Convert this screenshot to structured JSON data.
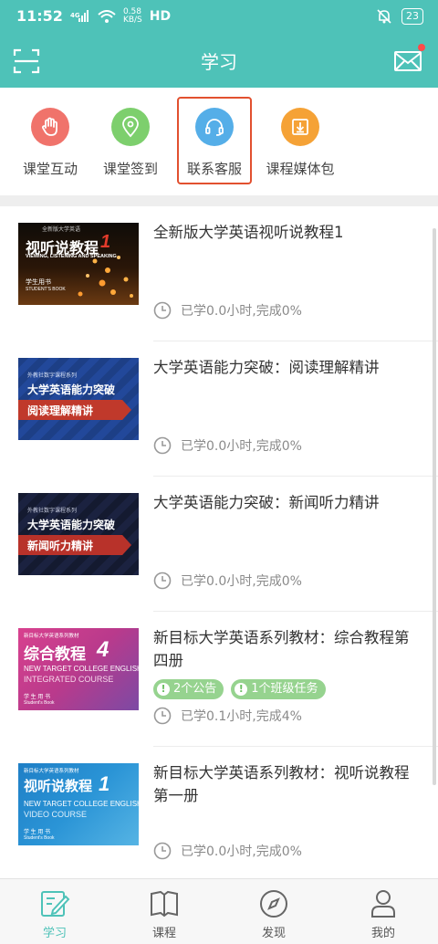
{
  "status": {
    "time": "11:52",
    "speed_value": "0.58",
    "speed_unit": "KB/S",
    "network": "HD",
    "battery": "23"
  },
  "header": {
    "title": "学习",
    "scan_icon": "scan-icon",
    "mail_icon": "mail-icon"
  },
  "quick_actions": [
    {
      "label": "课堂互动",
      "icon": "hand-icon",
      "color": "#f0736b"
    },
    {
      "label": "课堂签到",
      "icon": "location-pin-icon",
      "color": "#7dcf6d"
    },
    {
      "label": "联系客服",
      "icon": "headset-icon",
      "color": "#55aee8"
    },
    {
      "label": "课程媒体包",
      "icon": "download-icon",
      "color": "#f5a236"
    }
  ],
  "courses": [
    {
      "title": "全新版大学英语视听说教程1",
      "progress": "已学0.0小时,完成0%",
      "cover": {
        "top": "全新版大学英语",
        "title": "视听说教程",
        "sub": "VIEWING, LISTENING AND SPEAKING",
        "book": "学生用书",
        "book_en": "STUDENT'S BOOK",
        "num": "1"
      }
    },
    {
      "title": "大学英语能力突破：阅读理解精讲",
      "progress": "已学0.0小时,完成0%",
      "cover": {
        "series": "外教社数字课程系列",
        "title": "大学英语能力突破",
        "banner": "阅读理解精讲"
      }
    },
    {
      "title": "大学英语能力突破：新闻听力精讲",
      "progress": "已学0.0小时,完成0%",
      "cover": {
        "series": "外教社数字课程系列",
        "title": "大学英语能力突破",
        "banner": "新闻听力精讲"
      }
    },
    {
      "title": "新目标大学英语系列教材：综合教程第四册",
      "progress": "已学0.1小时,完成4%",
      "tags": [
        "2个公告",
        "1个班级任务"
      ],
      "cover": {
        "series": "新目标大学英语系列教材",
        "title": "综合教程",
        "num": "4",
        "en1": "NEW TARGET COLLEGE ENGLISH",
        "en2": "INTEGRATED COURSE",
        "book": "学 生 用 书",
        "book_en": "Student's Book"
      }
    },
    {
      "title": "新目标大学英语系列教材：视听说教程第一册",
      "progress": "已学0.0小时,完成0%",
      "cover": {
        "series": "新目标大学英语系列教材",
        "title": "视听说教程",
        "num": "1",
        "en1": "NEW TARGET COLLEGE ENGLISH",
        "en2": "VIDEO COURSE",
        "book": "学 生 用 书",
        "book_en": "Student's Book"
      }
    }
  ],
  "tabs": [
    {
      "label": "学习",
      "icon": "edit-note-icon",
      "active": true
    },
    {
      "label": "课程",
      "icon": "book-icon",
      "active": false
    },
    {
      "label": "发现",
      "icon": "compass-icon",
      "active": false
    },
    {
      "label": "我的",
      "icon": "person-icon",
      "active": false
    }
  ]
}
